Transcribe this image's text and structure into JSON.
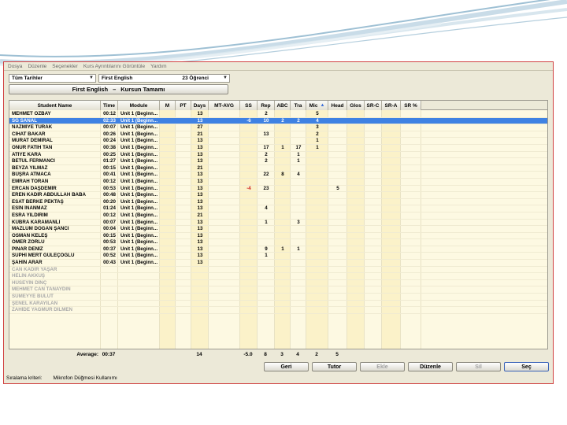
{
  "menu": [
    "Dosya",
    "Düzenle",
    "Seçenekler",
    "Kurs Ayrıntılarını Görüntüle",
    "Yardım"
  ],
  "filters": {
    "date": "Tüm Tarihler",
    "course": "First English",
    "student_count": "23 Öğrenci"
  },
  "course_button": {
    "left": "First English",
    "dash": "–",
    "right": "Kursun Tamamı"
  },
  "columns": [
    "Student Name",
    "Time",
    "Module",
    "M",
    "PT",
    "Days",
    "MT-AVG",
    "SS",
    "Rep",
    "ABC",
    "Tra",
    "Mic",
    "Head",
    "Glos",
    "SR-C",
    "SR-A",
    "SR %"
  ],
  "sorted_column": "Mic",
  "rows": [
    {
      "name": "MEHMET ÖZBAY",
      "time": "00:12",
      "module": "Unit 1 (Beginn...",
      "days": "13",
      "ss": "",
      "rep": "2",
      "abc": "",
      "tra": "",
      "mic": "5",
      "head": ""
    },
    {
      "name": "SG SANAL",
      "time": "02:33",
      "module": "Unit 1 (Beginn...",
      "days": "13",
      "ss": "-6",
      "rep": "10",
      "abc": "2",
      "tra": "2",
      "mic": "4",
      "head": "",
      "selected": true
    },
    {
      "name": "NAZMİYE TURAK",
      "time": "00:07",
      "module": "Unit 1 (Beginn...",
      "days": "27",
      "ss": "",
      "rep": "",
      "abc": "",
      "tra": "",
      "mic": "3",
      "head": ""
    },
    {
      "name": "CİHAT BAKAR",
      "time": "00:26",
      "module": "Unit 1 (Beginn...",
      "days": "21",
      "ss": "",
      "rep": "13",
      "abc": "",
      "tra": "",
      "mic": "2",
      "head": ""
    },
    {
      "name": "MURAT DEMİRAL",
      "time": "00:24",
      "module": "Unit 1 (Beginn...",
      "days": "13",
      "ss": "",
      "rep": "",
      "abc": "",
      "tra": "",
      "mic": "1",
      "head": ""
    },
    {
      "name": "ONUR FATİH TAN",
      "time": "00:38",
      "module": "Unit 1 (Beginn...",
      "days": "13",
      "ss": "",
      "rep": "17",
      "abc": "1",
      "tra": "17",
      "mic": "1",
      "head": ""
    },
    {
      "name": "ATİYE KARA",
      "time": "00:25",
      "module": "Unit 1 (Beginn...",
      "days": "13",
      "ss": "",
      "rep": "2",
      "abc": "",
      "tra": "1",
      "mic": "",
      "head": ""
    },
    {
      "name": "BETÜL FERMANCI",
      "time": "01:27",
      "module": "Unit 1 (Beginn...",
      "days": "13",
      "ss": "",
      "rep": "2",
      "abc": "",
      "tra": "1",
      "mic": "",
      "head": ""
    },
    {
      "name": "BEYZA YILMAZ",
      "time": "00:15",
      "module": "Unit 1 (Beginn...",
      "days": "21",
      "ss": "",
      "rep": "",
      "abc": "",
      "tra": "",
      "mic": "",
      "head": ""
    },
    {
      "name": "BÜŞRA ATMACA",
      "time": "00:41",
      "module": "Unit 1 (Beginn...",
      "days": "13",
      "ss": "",
      "rep": "22",
      "abc": "8",
      "tra": "4",
      "mic": "",
      "head": ""
    },
    {
      "name": "EMRAH TORAN",
      "time": "00:12",
      "module": "Unit 1 (Beginn...",
      "days": "13",
      "ss": "",
      "rep": "",
      "abc": "",
      "tra": "",
      "mic": "",
      "head": ""
    },
    {
      "name": "ERCAN DAŞDEMİR",
      "time": "00:53",
      "module": "Unit 1 (Beginn...",
      "days": "13",
      "ss": "-4",
      "rep": "23",
      "abc": "",
      "tra": "",
      "mic": "",
      "head": "5"
    },
    {
      "name": "EREN KADİR ABDULLAH BABA",
      "time": "00:48",
      "module": "Unit 1 (Beginn...",
      "days": "13",
      "ss": "",
      "rep": "",
      "abc": "",
      "tra": "",
      "mic": "",
      "head": ""
    },
    {
      "name": "ESAT BERKE PEKTAŞ",
      "time": "00:20",
      "module": "Unit 1 (Beginn...",
      "days": "13",
      "ss": "",
      "rep": "",
      "abc": "",
      "tra": "",
      "mic": "",
      "head": ""
    },
    {
      "name": "ESİN İNANMAZ",
      "time": "01:24",
      "module": "Unit 1 (Beginn...",
      "days": "13",
      "ss": "",
      "rep": "4",
      "abc": "",
      "tra": "",
      "mic": "",
      "head": ""
    },
    {
      "name": "ESRA YILDIRIM",
      "time": "00:12",
      "module": "Unit 1 (Beginn...",
      "days": "21",
      "ss": "",
      "rep": "",
      "abc": "",
      "tra": "",
      "mic": "",
      "head": ""
    },
    {
      "name": "KÜBRA KARAMANLI",
      "time": "00:07",
      "module": "Unit 1 (Beginn...",
      "days": "13",
      "ss": "",
      "rep": "1",
      "abc": "",
      "tra": "3",
      "mic": "",
      "head": ""
    },
    {
      "name": "MAZLUM DOĞAN ŞANCI",
      "time": "00:04",
      "module": "Unit 1 (Beginn...",
      "days": "13",
      "ss": "",
      "rep": "",
      "abc": "",
      "tra": "",
      "mic": "",
      "head": ""
    },
    {
      "name": "OSMAN KELEŞ",
      "time": "00:15",
      "module": "Unit 1 (Beginn...",
      "days": "13",
      "ss": "",
      "rep": "",
      "abc": "",
      "tra": "",
      "mic": "",
      "head": ""
    },
    {
      "name": "ÖMER ZORLU",
      "time": "00:53",
      "module": "Unit 1 (Beginn...",
      "days": "13",
      "ss": "",
      "rep": "",
      "abc": "",
      "tra": "",
      "mic": "",
      "head": ""
    },
    {
      "name": "PINAR DENİZ",
      "time": "00:37",
      "module": "Unit 1 (Beginn...",
      "days": "13",
      "ss": "",
      "rep": "9",
      "abc": "1",
      "tra": "1",
      "mic": "",
      "head": ""
    },
    {
      "name": "SUPHİ MERT GÜLEÇOĞLU",
      "time": "00:52",
      "module": "Unit 1 (Beginn...",
      "days": "13",
      "ss": "",
      "rep": "1",
      "abc": "",
      "tra": "",
      "mic": "",
      "head": ""
    },
    {
      "name": "ŞAHİN ARAR",
      "time": "00:43",
      "module": "Unit 1 (Beginn...",
      "days": "13",
      "ss": "",
      "rep": "",
      "abc": "",
      "tra": "",
      "mic": "",
      "head": ""
    },
    {
      "name": "CAN KADİR YAŞAR",
      "inactive": true
    },
    {
      "name": "HELİN AKKUŞ",
      "inactive": true
    },
    {
      "name": "HÜSEYİN DİNÇ",
      "inactive": true
    },
    {
      "name": "MEHMET CAN TANAYDIN",
      "inactive": true
    },
    {
      "name": "SÜMEYYE BULUT",
      "inactive": true
    },
    {
      "name": "ŞENEL KARAYILAN",
      "inactive": true
    },
    {
      "name": "ZAHİDE YAĞMUR DİLMEN",
      "inactive": true
    }
  ],
  "average": {
    "label": "Average:",
    "time": "00:37",
    "days": "14",
    "ss": "-5.0",
    "rep": "8",
    "abc": "3",
    "tra": "4",
    "mic": "2",
    "head": "5"
  },
  "buttons": [
    {
      "label": "Geri",
      "disabled": false
    },
    {
      "label": "Tutor",
      "disabled": false
    },
    {
      "label": "Ekle",
      "disabled": true
    },
    {
      "label": "Düzenle",
      "disabled": false
    },
    {
      "label": "Sil",
      "disabled": true
    },
    {
      "label": "Seç",
      "disabled": false,
      "primary": true
    }
  ],
  "status": {
    "label": "Sıralama kriteri:",
    "value": "Mikrofon Düğmesi Kullanımı"
  }
}
